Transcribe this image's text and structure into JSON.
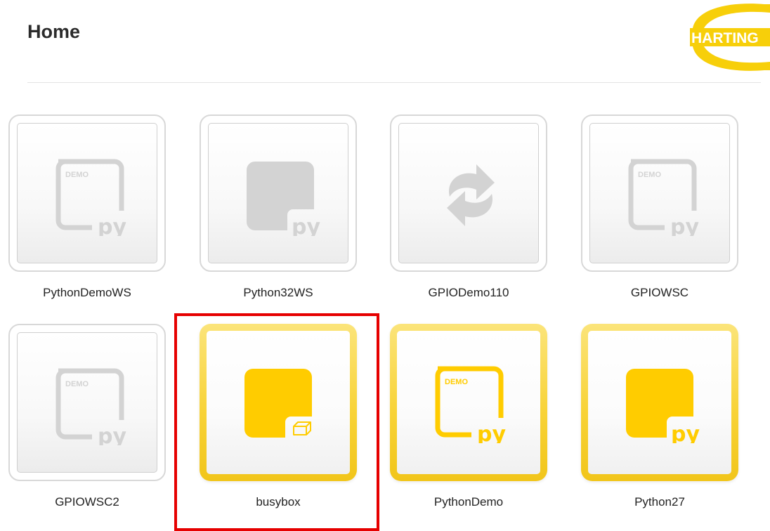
{
  "header": {
    "title": "Home",
    "logo": {
      "text": "HARTING",
      "color": "#f7cf0a",
      "text_color": "#ffffff"
    }
  },
  "colors": {
    "inactive_icon": "#d3d3d3",
    "active_icon": "#ffcc00",
    "highlight": "#e60000"
  },
  "apps": [
    {
      "name": "PythonDemoWS",
      "state": "inactive",
      "icon": "python-demo-icon",
      "badge_top": "DEMO",
      "badge_bottom": "py"
    },
    {
      "name": "Python32WS",
      "state": "inactive",
      "icon": "python-icon",
      "badge_bottom": "py"
    },
    {
      "name": "GPIODemo110",
      "state": "inactive",
      "icon": "sync-arrows-icon"
    },
    {
      "name": "GPIOWSC",
      "state": "inactive",
      "icon": "python-demo-icon",
      "badge_top": "DEMO",
      "badge_bottom": "py"
    },
    {
      "name": "GPIOWSC2",
      "state": "inactive",
      "icon": "python-demo-icon",
      "badge_top": "DEMO",
      "badge_bottom": "py"
    },
    {
      "name": "busybox",
      "state": "active",
      "icon": "container-icon",
      "highlighted": true
    },
    {
      "name": "PythonDemo",
      "state": "active",
      "icon": "python-demo-icon",
      "badge_top": "DEMO",
      "badge_bottom": "py"
    },
    {
      "name": "Python27",
      "state": "active",
      "icon": "python-icon",
      "badge_bottom": "py"
    }
  ]
}
